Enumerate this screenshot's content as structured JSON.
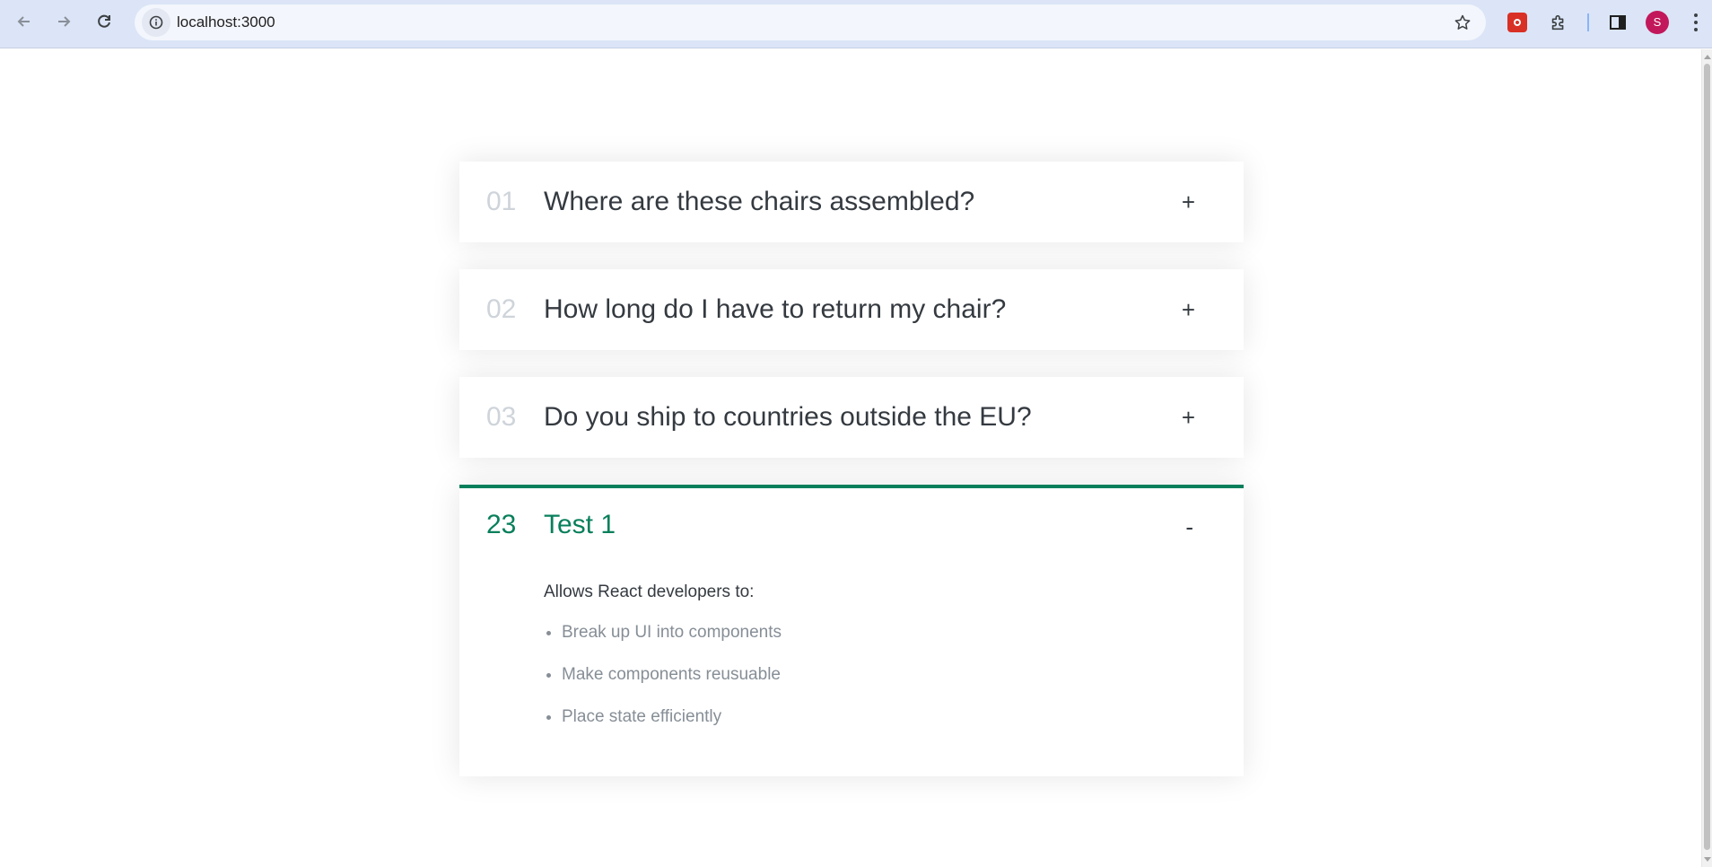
{
  "browser": {
    "url": "localhost:3000",
    "avatar_letter": "S"
  },
  "faq": [
    {
      "num": "01",
      "title": "Where are these chairs assembled?",
      "toggle": "+"
    },
    {
      "num": "02",
      "title": "How long do I have to return my chair?",
      "toggle": "+"
    },
    {
      "num": "03",
      "title": "Do you ship to countries outside the EU?",
      "toggle": "+"
    },
    {
      "num": "23",
      "title": "Test 1",
      "toggle": "-"
    }
  ],
  "open_item": {
    "intro": "Allows React developers to:",
    "bullets": [
      "Break up UI into components",
      "Make components reusuable",
      "Place state efficiently"
    ]
  },
  "colors": {
    "accent": "#087f5b",
    "chrome_bg": "#dbe5f7"
  }
}
